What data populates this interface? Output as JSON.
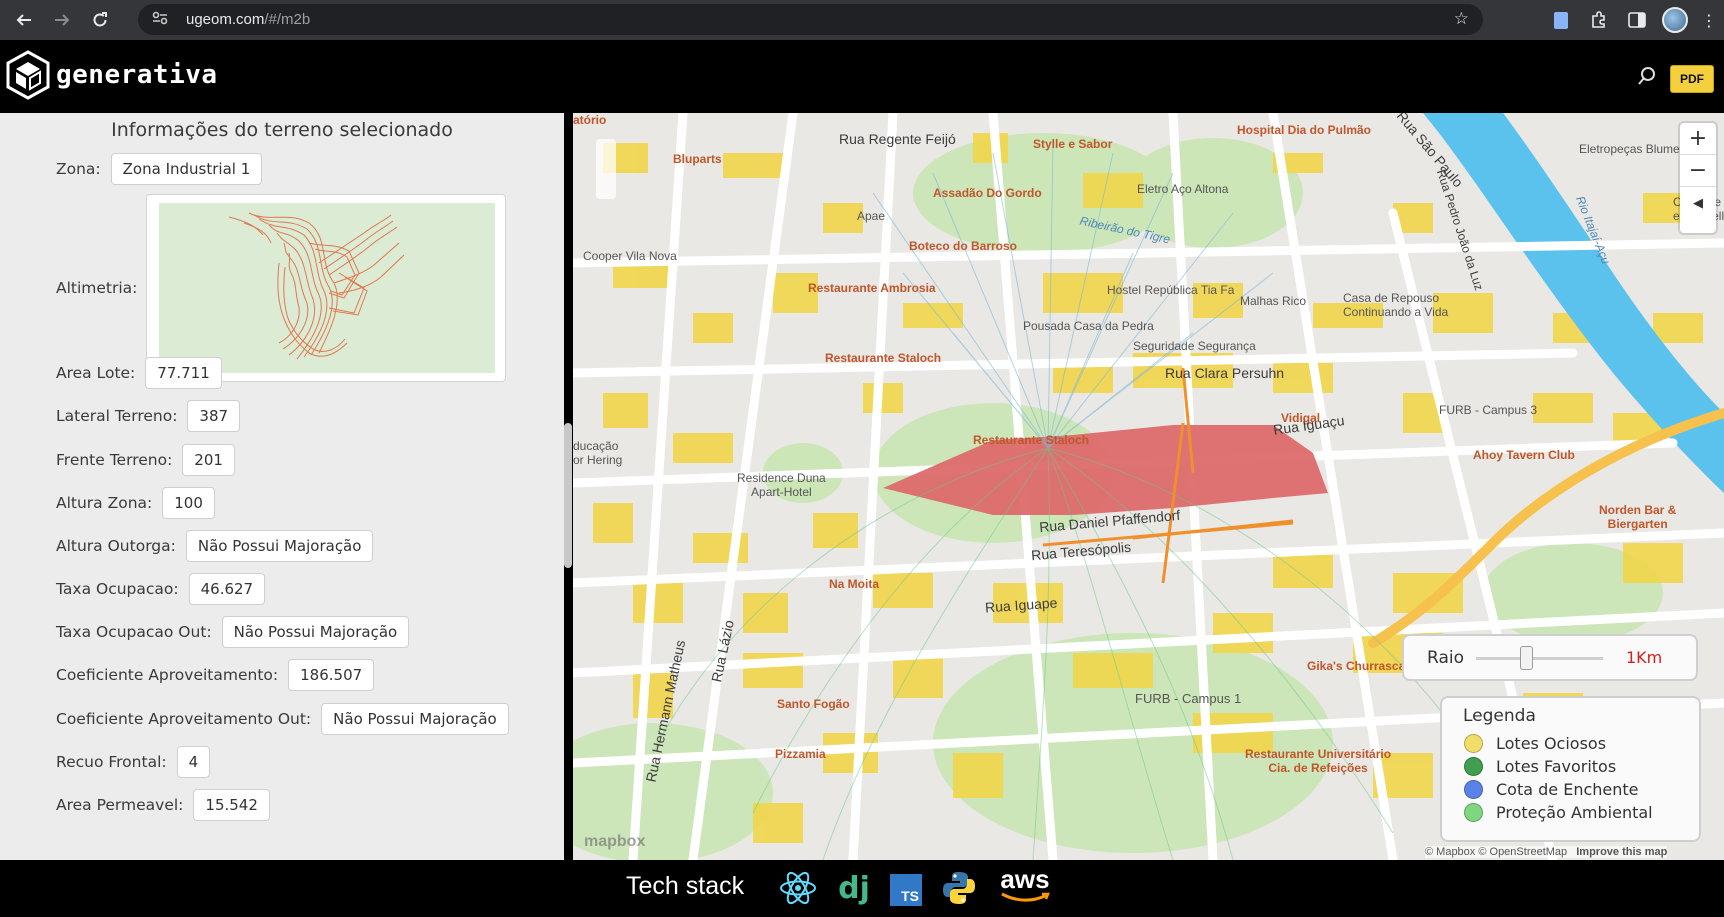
{
  "browser": {
    "url_host": "ugeom.com",
    "url_path": "/#/m2b",
    "back_icon": "arrow-left",
    "forward_icon": "arrow-right",
    "reload_icon": "reload"
  },
  "app": {
    "brand": "generativa",
    "pdf_label": "PDF",
    "colors": {
      "pdf": "#f4d03f",
      "header": "#000000"
    }
  },
  "panel": {
    "title": "Informações do terreno selecionado",
    "zona": {
      "label": "Zona:",
      "value": "Zona Industrial 1"
    },
    "altimetria_label": "Altimetria:",
    "fields": [
      {
        "label": "Area Lote:",
        "value": "77.711"
      },
      {
        "label": "Lateral Terreno:",
        "value": "387"
      },
      {
        "label": "Frente Terreno:",
        "value": "201"
      },
      {
        "label": "Altura Zona:",
        "value": "100"
      },
      {
        "label": "Altura Outorga:",
        "value": "Não Possui Majoração"
      },
      {
        "label": "Taxa Ocupacao:",
        "value": "46.627"
      },
      {
        "label": "Taxa Ocupacao Out:",
        "value": "Não Possui Majoração"
      },
      {
        "label": "Coeficiente Aproveitamento:",
        "value": "186.507"
      },
      {
        "label": "Coeficiente Aproveitamento Out:",
        "value": "Não Possui Majoração"
      },
      {
        "label": "Recuo Frontal:",
        "value": "4"
      },
      {
        "label": "Area Permeavel:",
        "value": "15.542"
      }
    ]
  },
  "map": {
    "labels": {
      "rua_regente": "Rua Regente Feijó",
      "stylle": "Stylle e Sabor",
      "hospital": "Hospital Dia do Pulmão",
      "rua_sao_paulo": "Rua São Paulo",
      "eletropecas": "Eletropeças Blumenau",
      "bluparts": "Bluparts",
      "assadao": "Assadão Do Gordo",
      "eletro_aco": "Eletro Aço Altona",
      "apae": "Apae",
      "ribeirao": "Ribeirão do Tigre",
      "clube": "Clube de Caça\ne Tiro Tell",
      "boteco": "Boteco do Barroso",
      "cooper": "Cooper Vila Nova",
      "rio": "Rio Itajaí-Açu",
      "rua_pedro": "Rua Pedro João da Luz",
      "restaurante_ambrosia": "Restaurante Ambrosia",
      "hostel": "Hostel República Tia Fa",
      "malhas": "Malhas Rico",
      "casa_repouso": "Casa de Repouso\nContinuando a Vida",
      "pousada": "Pousada Casa da Pedra",
      "seguridade": "Seguridade Segurança",
      "restaurante_staloch_1": "Restaurante Staloch",
      "rua_clara": "Rua Clara Persuhn",
      "vidigal": "Vidigal",
      "furb3": "FURB - Campus 3",
      "restaurante_staloch_2": "Restaurante Staloch",
      "rua_iguacu": "Rua Iguaçu",
      "educacao": "ducação\nor Hering",
      "ahoy": "Ahoy Tavern Club",
      "residence": "Residence Duna\nApart-Hotel",
      "norden": "Norden Bar &\nBiergarten",
      "rua_daniel": "Rua Daniel Pfaffendorf",
      "rua_teresopolis": "Rua Teresópolis",
      "na_moita": "Na Moita",
      "rua_iguape": "Rua Iguape",
      "rua_lazio": "Rua Lázio",
      "rua_hermann": "Rua Hermann Matheus",
      "gikas": "Gika's Churrascaria",
      "furb1": "FURB - Campus 1",
      "santo_fogao": "Santo Fogão",
      "pizzamia": "Pizzamia",
      "restaurante_univ": "Restaurante Universitário\nCia. de Refeições",
      "oratorio": "atório"
    },
    "zoom_in": "+",
    "zoom_out": "−",
    "compass": "◀",
    "raio": {
      "label": "Raio",
      "value": "1Km",
      "slider_fraction": 0.4
    },
    "legend": {
      "title": "Legenda",
      "items": [
        {
          "label": "Lotes Ociosos",
          "color": "#f2dc6a"
        },
        {
          "label": "Lotes Favoritos",
          "color": "#3f9e4f"
        },
        {
          "label": "Cota de Enchente",
          "color": "#5b82e6"
        },
        {
          "label": "Proteção Ambiental",
          "color": "#7fd67f"
        }
      ]
    },
    "attribution": "© Mapbox © OpenStreetMap",
    "improve": "Improve this map",
    "mapbox_logo": "mapbox"
  },
  "footer": {
    "tech_stack_label": "Tech stack",
    "django": "dj",
    "ts": "TS",
    "aws": "aws"
  }
}
